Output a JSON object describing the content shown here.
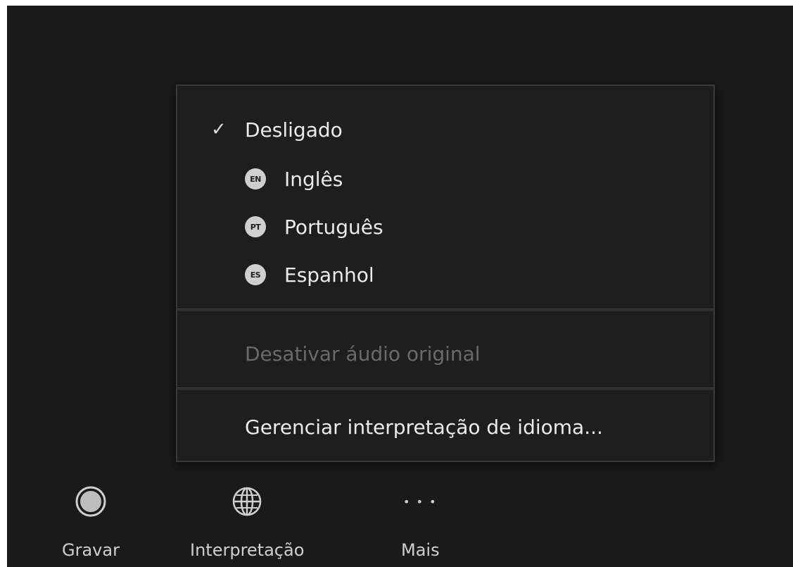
{
  "menu": {
    "items": [
      {
        "label": "Desligado",
        "checked": true,
        "badge": ""
      },
      {
        "label": "Inglês",
        "checked": false,
        "badge": "EN"
      },
      {
        "label": "Português",
        "checked": false,
        "badge": "PT"
      },
      {
        "label": "Espanhol",
        "checked": false,
        "badge": "ES"
      }
    ],
    "check_glyph": "✓",
    "disable_original_audio_label": "Desativar áudio original",
    "manage_label": "Gerenciar interpretação de idioma..."
  },
  "toolbar": {
    "record_label": "Gravar",
    "interpretation_label": "Interpretação",
    "more_label": "Mais",
    "more_glyph": "• • •"
  },
  "colors": {
    "background": "#1a1a1a",
    "menu_background": "#1e1e1e",
    "text": "#ececec",
    "disabled_text": "#6a6a6a",
    "badge_background": "#cfcfcf"
  }
}
